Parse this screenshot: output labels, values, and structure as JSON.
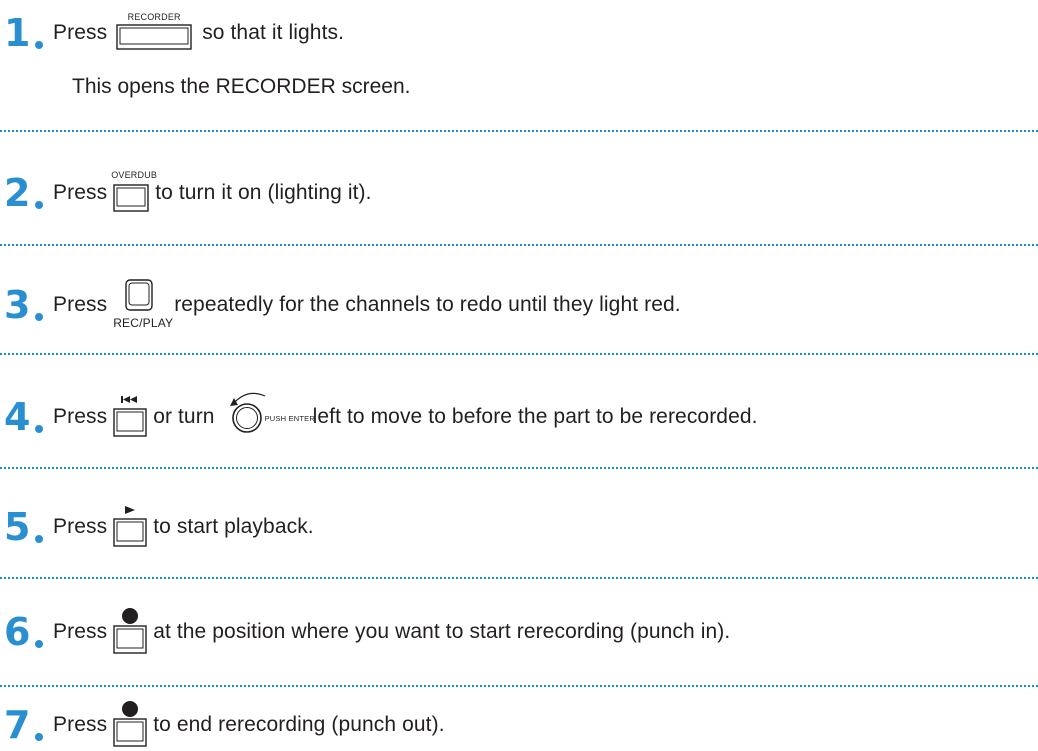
{
  "steps": [
    {
      "num": "1",
      "pre": "Press",
      "button": "RECORDER",
      "post": "so that it lights.",
      "sub": "This opens the RECORDER screen."
    },
    {
      "num": "2",
      "pre": "Press",
      "button": "OVERDUB",
      "post": "to turn it on (lighting it)."
    },
    {
      "num": "3",
      "pre": "Press",
      "button": "REC/PLAY",
      "post": "repeatedly for the channels to redo until they light red."
    },
    {
      "num": "4",
      "pre": "Press",
      "mid": "or turn",
      "dial": "PUSH ENTER",
      "post": "left to move to before the part to be rerecorded."
    },
    {
      "num": "5",
      "pre": "Press",
      "post": "to start playback."
    },
    {
      "num": "6",
      "pre": "Press",
      "post": "at the position where you want to start rerecording (punch in)."
    },
    {
      "num": "7",
      "pre": "Press",
      "post": "to end rerecording (punch out)."
    }
  ],
  "icons": {
    "accent": "#2a8fd1",
    "step4_button": "rewind-icon",
    "step5_button": "play-icon",
    "step6_button": "record-icon",
    "step7_button": "record-icon"
  }
}
